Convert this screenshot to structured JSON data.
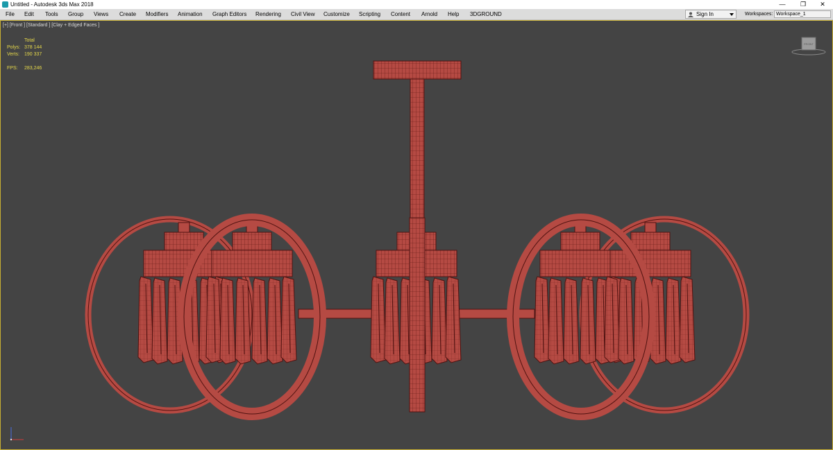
{
  "window": {
    "title": "Untitled - Autodesk 3ds Max 2018",
    "minimize": "—",
    "restore": "❐",
    "close": "✕"
  },
  "menu": {
    "items": [
      "File",
      "Edit",
      "Tools",
      "Group",
      "Views",
      "Create",
      "Modifiers",
      "Animation",
      "Graph Editors",
      "Rendering",
      "Civil View",
      "Customize",
      "Scripting",
      "Content",
      "Arnold",
      "Help",
      "3DGROUND"
    ],
    "sign_in": "Sign In",
    "workspaces_label": "Workspaces:",
    "workspace_value": "Workspace_1"
  },
  "viewport": {
    "label": "[+] [Front ] [Standard ] [Clay + Edged Faces ]",
    "stats": {
      "header": "Total",
      "polys_label": "Polys:",
      "polys_value": "378 144",
      "verts_label": "Verts:",
      "verts_value": "190 337",
      "fps_label": "FPS:",
      "fps_value": "283,246"
    },
    "viewcube_label": "FRONT",
    "model_color": "#b54a43",
    "wire_color": "#5a1512",
    "border_color": "#c9b033"
  }
}
